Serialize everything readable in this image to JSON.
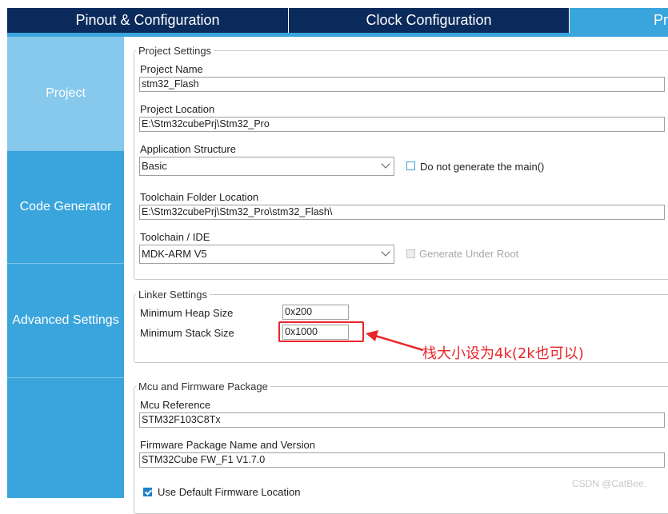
{
  "tabs": [
    {
      "label": "Pinout & Configuration"
    },
    {
      "label": "Clock Configuration"
    },
    {
      "label": "Pr"
    }
  ],
  "sidebar": {
    "items": [
      {
        "label": "Project"
      },
      {
        "label": "Code Generator"
      },
      {
        "label": "Advanced Settings"
      }
    ]
  },
  "project_settings": {
    "title": "Project Settings",
    "project_name_label": "Project Name",
    "project_name": "stm32_Flash",
    "project_location_label": "Project Location",
    "project_location": "E:\\Stm32cubePrj\\Stm32_Pro",
    "app_structure_label": "Application Structure",
    "app_structure": "Basic",
    "no_main_label": "Do not generate the main()",
    "toolchain_folder_label": "Toolchain Folder Location",
    "toolchain_folder": "E:\\Stm32cubePrj\\Stm32_Pro\\stm32_Flash\\",
    "toolchain_ide_label": "Toolchain / IDE",
    "toolchain_ide": "MDK-ARM V5",
    "generate_under_root_label": "Generate Under Root"
  },
  "linker_settings": {
    "title": "Linker Settings",
    "heap_label": "Minimum Heap Size",
    "heap_value": "0x200",
    "stack_label": "Minimum Stack Size",
    "stack_value": "0x1000"
  },
  "annotation": {
    "text": "栈大小设为4k(2k也可以)",
    "color": "#e8262a"
  },
  "mcu_firmware": {
    "title": "Mcu and Firmware Package",
    "mcu_reference_label": "Mcu Reference",
    "mcu_reference": "STM32F103C8Tx",
    "firmware_label": "Firmware Package Name and Version",
    "firmware": "STM32Cube FW_F1 V1.7.0",
    "use_default_label": "Use Default Firmware Location"
  },
  "watermark": "CSDN @CatBee.",
  "colors": {
    "tab_dark": "#0b2a5c",
    "accent": "#3aa5dc",
    "sidebar_active": "#86c9ec"
  }
}
